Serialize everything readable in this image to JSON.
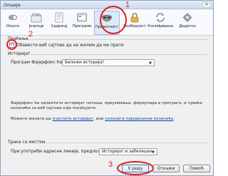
{
  "window": {
    "title": "Опције",
    "close_glyph": "×"
  },
  "toolbar": {
    "items": [
      {
        "label": "Опште",
        "icon": "switch-icon"
      },
      {
        "label": "Језичци",
        "icon": "tabs-icon"
      },
      {
        "label": "Садржај",
        "icon": "content-icon"
      },
      {
        "label": "Програми",
        "icon": "applications-icon"
      },
      {
        "label": "Приватност",
        "icon": "mask-icon"
      },
      {
        "label": "Безбедност",
        "icon": "lock-icon"
      },
      {
        "label": "Усклађивање",
        "icon": "sync-icon"
      },
      {
        "label": "Додатно",
        "icon": "gear-icon"
      }
    ],
    "selected": "Приватност"
  },
  "annotations": {
    "n1": "1",
    "n2": "2",
    "n3": "3",
    "color": "#e21b1b"
  },
  "tracking": {
    "heading": "Праћење",
    "checkbox_label": "Обавести веб сајтове да не желим да ме прате"
  },
  "history": {
    "heading": "Историјат",
    "program_label": "Програм Фајерфокс ће:",
    "program_value": "Бележи историјат",
    "desc_line1": "Фајерфокс ће запамтити историјат читања, преузимања, формулара и претраге, и чуваће",
    "desc_line2": "колачиће са веб сајтова које посећујете.",
    "maybe_text": "Можете желети да",
    "clear_link": "очистите историјат",
    "or_text": ", или",
    "remove_link": "уклоните појединачне колачиће",
    "period": "."
  },
  "location_bar": {
    "heading": "Трака са местом",
    "suggest_label": "При употреби адресне линије, предложи:",
    "suggest_value": "Историјат и забелешке"
  },
  "buttons": {
    "ok": "У реду",
    "cancel": "Откажи",
    "help": "Помоћ"
  }
}
